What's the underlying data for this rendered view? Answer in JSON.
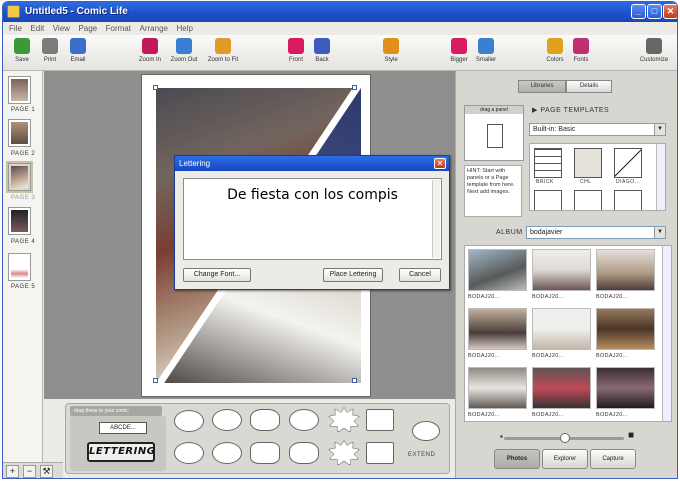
{
  "window": {
    "title": "Untitled5 - Comic Life"
  },
  "title_buttons": [
    "_",
    "□",
    "✕"
  ],
  "menu": [
    "File",
    "Edit",
    "View",
    "Page",
    "Format",
    "Arrange",
    "Help"
  ],
  "toolbar": [
    {
      "label": "Save",
      "icon": "save-icon",
      "color": "#3a9a3a"
    },
    {
      "label": "Print",
      "icon": "print-icon",
      "color": "#7b7b7b"
    },
    {
      "label": "Email",
      "icon": "email-icon",
      "color": "#3a6ec9"
    },
    {
      "label": "Zoom In",
      "icon": "zoom-in-icon",
      "color": "#c2185b"
    },
    {
      "label": "Zoom Out",
      "icon": "zoom-out-icon",
      "color": "#3b7fd3"
    },
    {
      "label": "Zoom to Fit",
      "icon": "zoom-to-fit-icon",
      "color": "#e39a2b"
    },
    {
      "label": "Front",
      "icon": "bring-front-icon",
      "color": "#d81b60"
    },
    {
      "label": "Back",
      "icon": "send-back-icon",
      "color": "#3c5bbd"
    },
    {
      "label": "Style",
      "icon": "style-icon",
      "color": "#e0901a"
    },
    {
      "label": "Bigger",
      "icon": "text-bigger-icon",
      "color": "#d81b60"
    },
    {
      "label": "Smaller",
      "icon": "text-smaller-icon",
      "color": "#3b7fd3"
    },
    {
      "label": "Colors",
      "icon": "colors-icon",
      "color": "#e0a020"
    },
    {
      "label": "Fonts",
      "icon": "fonts-icon",
      "color": "#c03070"
    },
    {
      "label": "Customize",
      "icon": "customize-icon",
      "color": "#666666"
    }
  ],
  "pages": [
    {
      "label": "PAGE 1"
    },
    {
      "label": "PAGE 2"
    },
    {
      "label": "PAGE 3",
      "selected": true
    },
    {
      "label": "PAGE 4"
    },
    {
      "label": "PAGE 5"
    }
  ],
  "bottom_tools": [
    "+",
    "−",
    "⚒"
  ],
  "dialog": {
    "title": "Lettering",
    "text": "De fiesta con los compis",
    "change_font": "Change Font...",
    "place": "Place Lettering",
    "cancel": "Cancel"
  },
  "lettering_panel": {
    "header": "drag these to your comic",
    "sample": "ABCDE...",
    "logo": "LETTERING",
    "extend": "EXTEND"
  },
  "right": {
    "segments": [
      "Libraries",
      "Details"
    ],
    "drag_panel": "drag a panel",
    "hint": "HINT: Start with panels or a Page template from here. Next add images.",
    "page_templates_label": "PAGE TEMPLATES",
    "templates_select": "Built-in: Basic",
    "template_names": [
      "BRICK",
      "CHL",
      "DIAGO...",
      "",
      "",
      ""
    ],
    "album_label": "ALBUM",
    "album_value": "bodajavier",
    "photo_label": "BODAJ20...",
    "bottom_tabs": [
      "Photos",
      "Explorer",
      "Capture"
    ]
  }
}
